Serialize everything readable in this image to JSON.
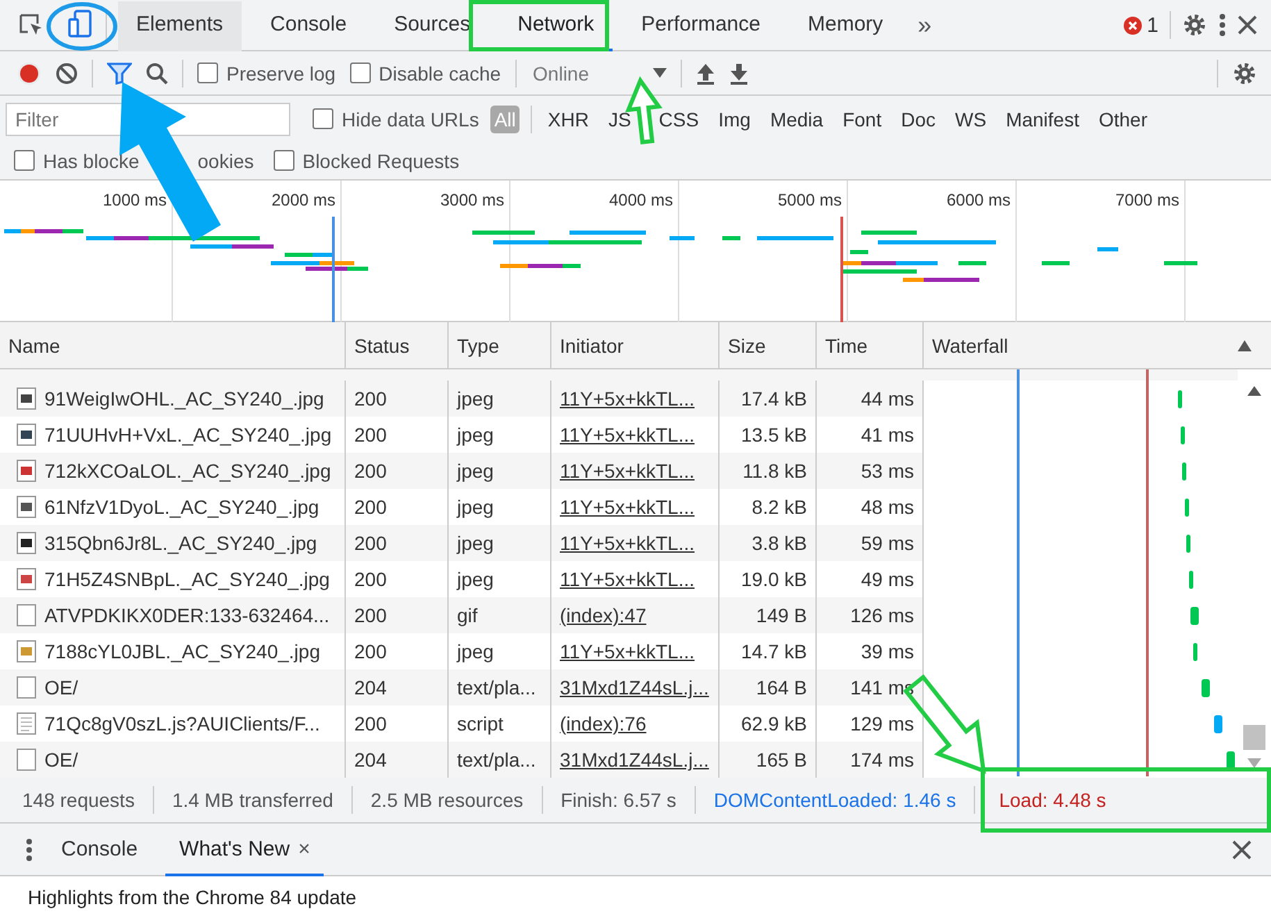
{
  "tabs": [
    {
      "label": "Elements",
      "selected": false
    },
    {
      "label": "Console",
      "selected": false
    },
    {
      "label": "Sources",
      "selected": false
    },
    {
      "label": "Network",
      "selected": true
    },
    {
      "label": "Performance",
      "selected": false
    },
    {
      "label": "Memory",
      "selected": false
    }
  ],
  "overflow": "»",
  "error_count": "1",
  "toolbar": {
    "preserve_log": {
      "label": "Preserve log",
      "checked": false
    },
    "disable_cache": {
      "label": "Disable cache",
      "checked": false
    },
    "throttling": "Online"
  },
  "filter": {
    "placeholder": "Filter",
    "hide_data_urls": {
      "label": "Hide data URLs",
      "checked": false
    },
    "types": [
      {
        "label": "All",
        "selected": true
      },
      {
        "label": "XHR",
        "selected": false
      },
      {
        "label": "JS",
        "selected": false
      },
      {
        "label": "CSS",
        "selected": false
      },
      {
        "label": "Img",
        "selected": false
      },
      {
        "label": "Media",
        "selected": false
      },
      {
        "label": "Font",
        "selected": false
      },
      {
        "label": "Doc",
        "selected": false
      },
      {
        "label": "WS",
        "selected": false
      },
      {
        "label": "Manifest",
        "selected": false
      },
      {
        "label": "Other",
        "selected": false
      }
    ]
  },
  "blocked": [
    {
      "label": "Has blocke",
      "label_end": "ookies",
      "checked": false
    },
    {
      "label": "Blocked Requests",
      "checked": false
    }
  ],
  "overview": {
    "ticks": [
      "1000 ms",
      "2000 ms",
      "3000 ms",
      "4000 ms",
      "5000 ms",
      "6000 ms",
      "7000 ms"
    ]
  },
  "table": {
    "columns": [
      "Name",
      "Status",
      "Type",
      "Initiator",
      "Size",
      "Time",
      "Waterfall"
    ],
    "rows": [
      {
        "kind": "image",
        "name": "91WeigIwOHL._AC_SY240_.jpg",
        "status": "200",
        "type": "jpeg",
        "initiator": "11Y+5x+kkTL...",
        "size": "17.4 kB",
        "time": "44 ms"
      },
      {
        "kind": "image",
        "name": "71UUHvH+VxL._AC_SY240_.jpg",
        "status": "200",
        "type": "jpeg",
        "initiator": "11Y+5x+kkTL...",
        "size": "13.5 kB",
        "time": "41 ms"
      },
      {
        "kind": "image",
        "name": "712kXCOaLOL._AC_SY240_.jpg",
        "status": "200",
        "type": "jpeg",
        "initiator": "11Y+5x+kkTL...",
        "size": "11.8 kB",
        "time": "53 ms"
      },
      {
        "kind": "image",
        "name": "61NfzV1DyoL._AC_SY240_.jpg",
        "status": "200",
        "type": "jpeg",
        "initiator": "11Y+5x+kkTL...",
        "size": "8.2 kB",
        "time": "48 ms"
      },
      {
        "kind": "image",
        "name": "315Qbn6Jr8L._AC_SY240_.jpg",
        "status": "200",
        "type": "jpeg",
        "initiator": "11Y+5x+kkTL...",
        "size": "3.8 kB",
        "time": "59 ms"
      },
      {
        "kind": "image",
        "name": "71H5Z4SNBpL._AC_SY240_.jpg",
        "status": "200",
        "type": "jpeg",
        "initiator": "11Y+5x+kkTL...",
        "size": "19.0 kB",
        "time": "49 ms"
      },
      {
        "kind": "blank",
        "name": "ATVPDKIKX0DER:133-632464...",
        "status": "200",
        "type": "gif",
        "initiator": "(index):47",
        "size": "149 B",
        "time": "126 ms"
      },
      {
        "kind": "image",
        "name": "7188cYL0JBL._AC_SY240_.jpg",
        "status": "200",
        "type": "jpeg",
        "initiator": "11Y+5x+kkTL...",
        "size": "14.7 kB",
        "time": "39 ms"
      },
      {
        "kind": "blank",
        "name": "OE/",
        "status": "204",
        "type": "text/pla...",
        "initiator": "31Mxd1Z44sL.j...",
        "size": "164 B",
        "time": "141 ms"
      },
      {
        "kind": "script",
        "name": "71Qc8gV0szL.js?AUIClients/F...",
        "status": "200",
        "type": "script",
        "initiator": "(index):76",
        "size": "62.9 kB",
        "time": "129 ms"
      },
      {
        "kind": "blank",
        "name": "OE/",
        "status": "204",
        "type": "text/pla...",
        "initiator": "31Mxd1Z44sL.j...",
        "size": "165 B",
        "time": "174 ms"
      }
    ]
  },
  "status_bar": [
    {
      "kind": "plain",
      "text": "148 requests"
    },
    {
      "kind": "plain",
      "text": "1.4 MB transferred"
    },
    {
      "kind": "plain",
      "text": "2.5 MB resources"
    },
    {
      "kind": "plain",
      "text": "Finish: 6.57 s"
    },
    {
      "kind": "dom",
      "text": "DOMContentLoaded: 1.46 s"
    },
    {
      "kind": "load",
      "text": "Load: 4.48 s"
    }
  ],
  "drawer": {
    "tabs": [
      {
        "label": "Console",
        "selected": false,
        "closable": false
      },
      {
        "label": "What's New",
        "selected": true,
        "closable": true
      }
    ],
    "close": "×",
    "content": "Highlights from the Chrome 84 update"
  }
}
